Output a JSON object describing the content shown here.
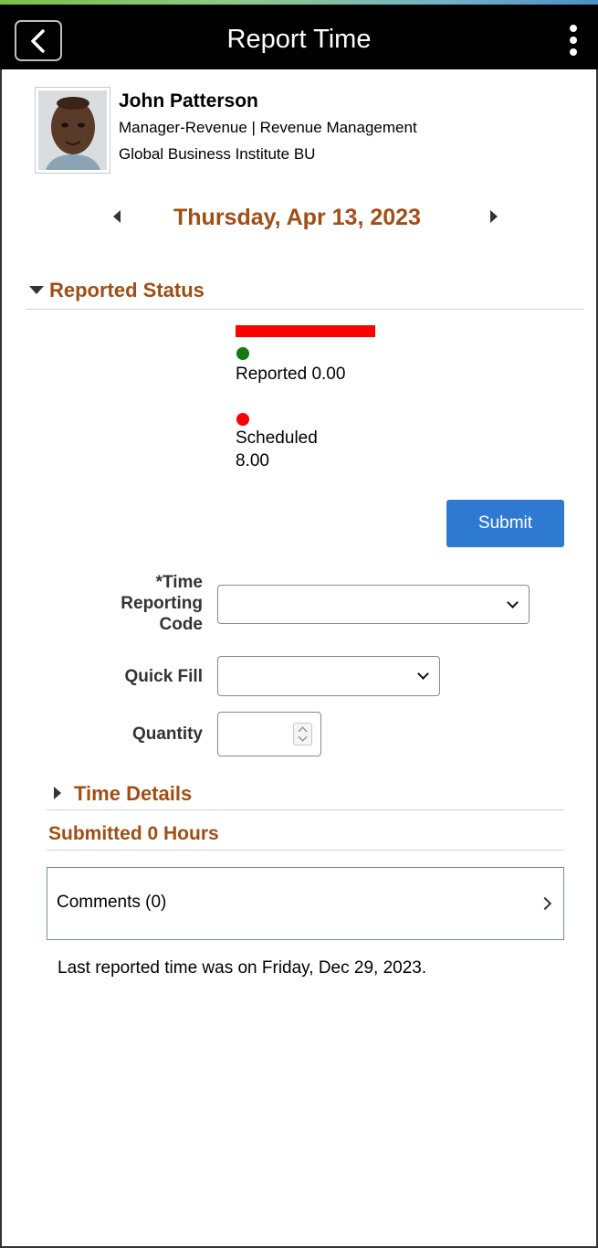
{
  "header": {
    "title": "Report Time",
    "back_icon": "chevron-left-icon",
    "menu_icon": "more-vertical-icon"
  },
  "employee": {
    "name": "John Patterson",
    "title_line": "Manager-Revenue | Revenue Management",
    "org_line": "Global Business Institute BU"
  },
  "date_nav": {
    "current_date": "Thursday, Apr 13, 2023"
  },
  "reported_status": {
    "heading": "Reported Status",
    "progress_fraction": 0.0,
    "reported_label": "Reported 0.00",
    "scheduled_label": "Scheduled",
    "scheduled_value": "8.00",
    "colors": {
      "reported": "#107c10",
      "scheduled": "#ff0000",
      "bar": "#ff0000"
    }
  },
  "actions": {
    "submit_label": "Submit"
  },
  "form": {
    "trc_label_line1": "*Time",
    "trc_label_line2": "Reporting",
    "trc_label_line3": "Code",
    "trc_value": "",
    "quick_fill_label": "Quick Fill",
    "quick_fill_value": "",
    "quantity_label": "Quantity",
    "quantity_value": ""
  },
  "time_details": {
    "heading": "Time Details"
  },
  "submitted": {
    "heading": "Submitted 0 Hours"
  },
  "comments": {
    "label": "Comments (0)"
  },
  "footer_note": "Last reported time was on Friday, Dec 29, 2023.",
  "colors": {
    "accent": "#a04e14",
    "button": "#2e7ad1",
    "header_bg": "#000000"
  }
}
